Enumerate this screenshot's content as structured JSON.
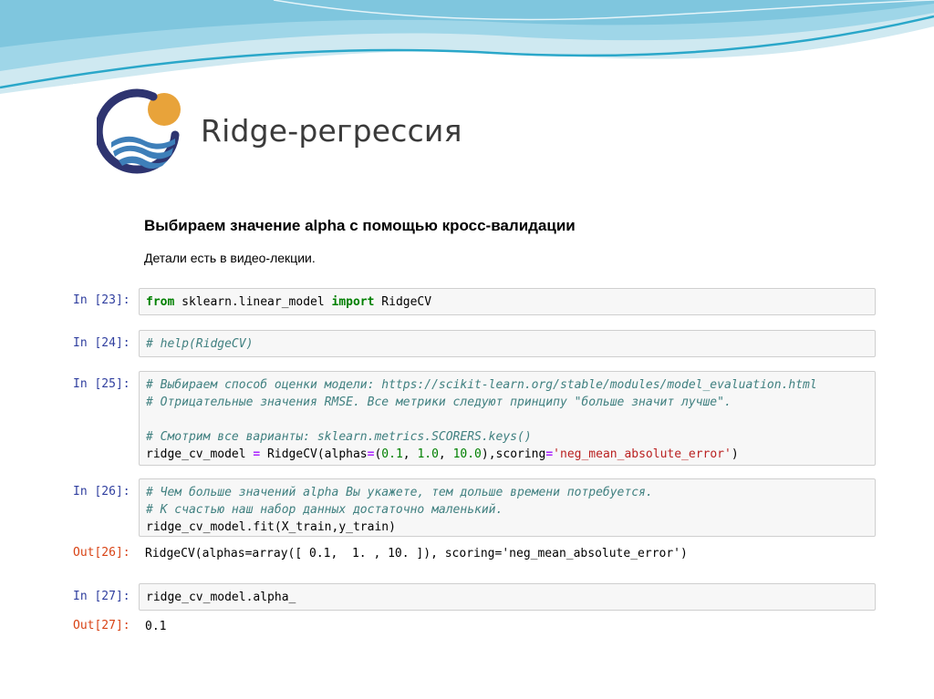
{
  "slide": {
    "title": "Ridge-регрессия",
    "colors": {
      "sun": "#e8a33a",
      "ring": "#2e3470",
      "waves": "#3e7fb9",
      "wave_top": "#7fd3ea"
    }
  },
  "notebook": {
    "heading": "Выбираем значение alpha с помощью кросс-валидации",
    "text": "Детали есть в видео-лекции.",
    "cells": [
      {
        "prompt": "In [23]:",
        "lines": [
          "from sklearn.linear_model import RidgeCV"
        ]
      },
      {
        "prompt": "In [24]:",
        "lines": [
          "# help(RidgeCV)"
        ]
      },
      {
        "prompt": "In [25]:",
        "lines": [
          "# Выбираем способ оценки модели: https://scikit-learn.org/stable/modules/model_evaluation.html",
          "# Отрицательные значения RMSE. Все метрики следуют принципу \"больше значит лучше\".",
          "",
          "# Смотрим все варианты: sklearn.metrics.SCORERS.keys()",
          "ridge_cv_model = RidgeCV(alphas=(0.1, 1.0, 10.0),scoring='neg_mean_absolute_error')"
        ]
      },
      {
        "prompt": "In [26]:",
        "lines": [
          "# Чем больше значений alpha Вы укажете, тем дольше времени потребуется.",
          "# К счастью наш набор данных достаточно маленький.",
          "ridge_cv_model.fit(X_train,y_train)"
        ],
        "out_prompt": "Out[26]:",
        "output": "RidgeCV(alphas=array([ 0.1,  1. , 10. ]), scoring='neg_mean_absolute_error')"
      },
      {
        "prompt": "In [27]:",
        "lines": [
          "ridge_cv_model.alpha_"
        ],
        "out_prompt": "Out[27]:",
        "output": "0.1"
      }
    ]
  }
}
